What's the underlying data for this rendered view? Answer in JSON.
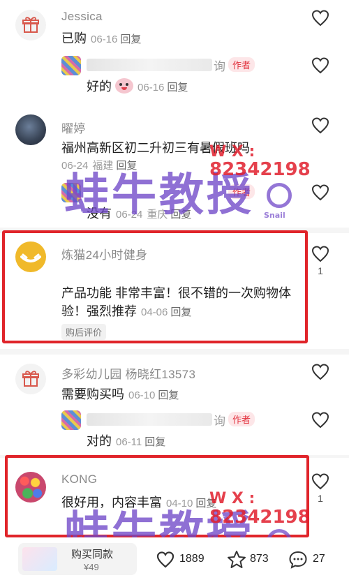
{
  "comments": [
    {
      "user": "Jessica",
      "text": "已购",
      "date": "06-16",
      "reply": "回复",
      "sub_reply": {
        "name_suffix": "询",
        "badge": "作者",
        "text": "好的",
        "date": "06-16",
        "reply": "回复"
      }
    },
    {
      "user": "曜婷",
      "text": "福州高新区初二升初三有暑假班吗",
      "date": "06-24",
      "location": "福建",
      "reply": "回复",
      "sub_reply": {
        "badge": "作者",
        "text": "没有",
        "date": "06-24",
        "location": "重庆",
        "reply": "回复"
      }
    },
    {
      "user": "炼猫24小时健身",
      "text_line1": "产品功能 非常丰富！很不错的一次购物体",
      "text_line2": "验！强烈推荐",
      "date": "04-06",
      "reply": "回复",
      "tag": "购后评价",
      "likes": "1"
    },
    {
      "user": "多彩幼儿园 杨晓红13573",
      "text": "需要购买吗",
      "date": "06-10",
      "reply": "回复",
      "sub_reply": {
        "name_suffix": "询",
        "badge": "作者",
        "text": "对的",
        "date": "06-11",
        "reply": "回复"
      }
    },
    {
      "user": "KONG",
      "text": "很好用，内容丰富",
      "date": "04-10",
      "reply": "回复",
      "likes": "1"
    }
  ],
  "watermark": {
    "main": "蛙牛教授",
    "wx": "W X :",
    "phone": "82342198",
    "small": "Snail"
  },
  "bottom_bar": {
    "buy_label": "购买同款",
    "price": "¥49",
    "likes": "1889",
    "stars": "873",
    "comments": "27"
  },
  "colors": {
    "highlight_border": "#e0242a",
    "author_badge": "#e2333f",
    "watermark_purple": "#7048c8"
  }
}
